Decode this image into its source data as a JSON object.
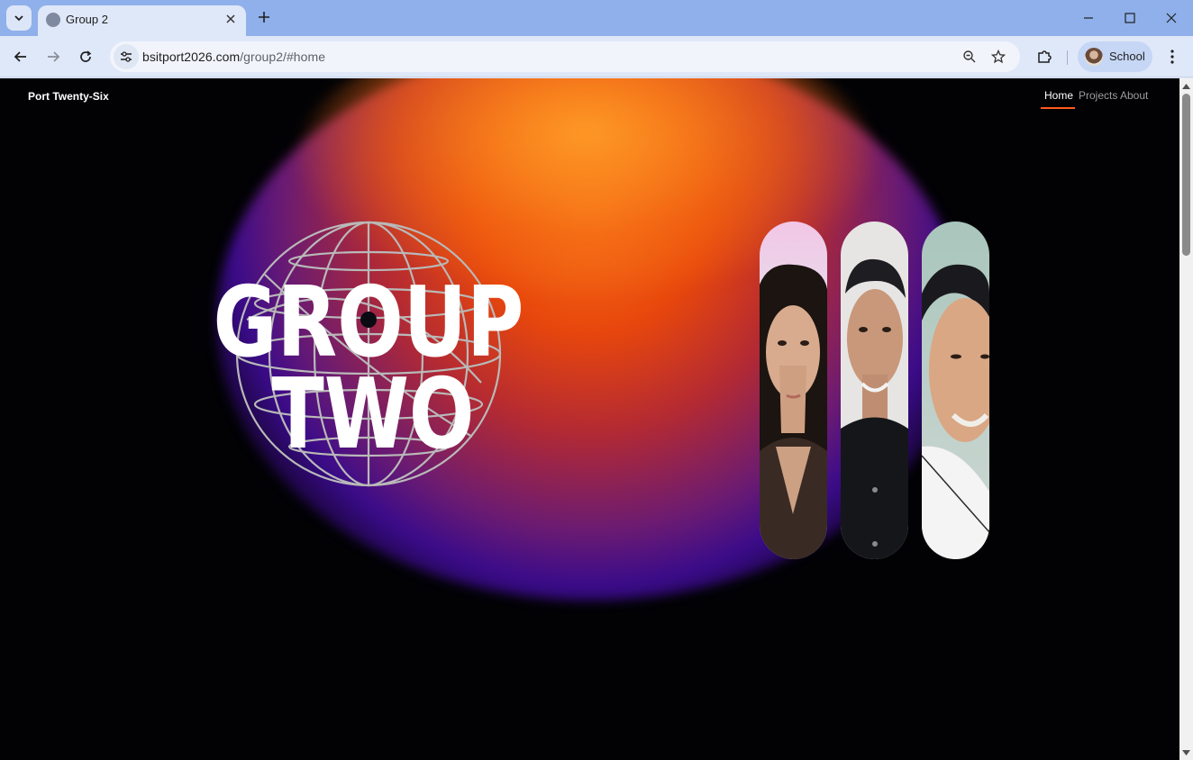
{
  "browser": {
    "tab_title": "Group 2",
    "url_host": "bsitport2026.com",
    "url_path": "/group2/#home",
    "profile_label": "School"
  },
  "site": {
    "brand": "Port Twenty-Six",
    "nav": [
      {
        "label": "Home",
        "active": true
      },
      {
        "label": "Projects",
        "active": false
      },
      {
        "label": "About",
        "active": false
      }
    ],
    "hero": {
      "logo_line1": "GROUP",
      "logo_line2": "TWO"
    },
    "members": [
      "member-photo-1",
      "member-photo-2",
      "member-photo-3"
    ]
  },
  "colors": {
    "accent": "#ff5a1f",
    "background": "#020205",
    "glow_orange": "#f7731a",
    "glow_purple": "#3a0b8a"
  }
}
